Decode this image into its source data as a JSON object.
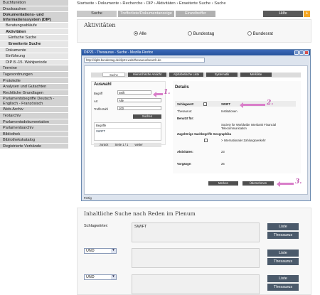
{
  "sidebar": {
    "items": [
      "Buchfunktion",
      "Drucksachen",
      "Dokumentations- und Informationssystem (DIP)",
      "Beratungsabläufe",
      "Aktivitäten",
      "Einfache Suche",
      "Erweiterte Suche",
      "Dokumente",
      "Einführung",
      "DIP 8.-15. Wahlperiode",
      "Termine",
      "Tagesordnungen",
      "Protokolle",
      "Analysen und Gutachten",
      "Rechtliche Grundlagen",
      "Parlamentsbegriffe Deutsch - Englisch - Französisch",
      "Web-Archiv",
      "Textarchiv",
      "Parlamentsdokumentation",
      "Parlamentsarchiv",
      "Bibliothek",
      "Bibliothekskatalog",
      "Registrierte Verbände"
    ]
  },
  "breadcrumb": "Startseite › Dokumente › Recherche › DIP › Aktivitäten › Erweiterte Suche › Suche",
  "tabs": {
    "suche": "Suche",
    "trefferliste": "Trefferliste/Dokumentanzeige",
    "einzel": "Einzeltreffer",
    "hilfe": "Hilfe",
    "plus": "+"
  },
  "aktivitaeten": {
    "title": "Aktivitäten",
    "options": [
      "Alle",
      "Bundestag",
      "Bundesrat"
    ],
    "selected": "Alle"
  },
  "firefox": {
    "title": "DIP21 - Thesaurus - Suche - Mozilla Firefox",
    "url": "http://dipbt.bundestag.de/dip21.web/thesaurus/search.do",
    "tabs": [
      "Suche",
      "Hierarchische Ansicht",
      "Alphabetische Liste",
      "Systematik",
      "Merkliste"
    ],
    "auswahl": {
      "title": "Auswahl",
      "begriff_label": "Begriff",
      "begriff_value": "swift",
      "art_label": "Art",
      "art_value": "Alle",
      "trefferzahl_label": "Trefferzahl",
      "trefferzahl_value": "100",
      "suchen": "Suchen",
      "list_header": "Begriffe",
      "list_item": "SWIFT",
      "zurueck": "zurück",
      "seite": "Seite 1 / 1",
      "weiter": "weiter"
    },
    "details": {
      "title": "Details",
      "schlagwort_label": "Schlagwort:",
      "schlagwort_value": "SWIFT",
      "thesaurus_label": "Thesaurus:",
      "thesaurus_value": "Institutionen",
      "benutzt_label": "Benutzt für:",
      "benutzt_value": "Society for Worldwide Interbank Financial Telecommunication",
      "zugehoerige_label": "Zugehörige Sachbegriffe Geographika",
      "zugehoerige_value": "> Internationaler Zahlungsverkehr",
      "aktivitaeten_label": "Aktivitäten:",
      "aktivitaeten_value": "23",
      "vorgaenge_label": "Vorgänge:",
      "vorgaenge_value": "26",
      "merken": "Merken",
      "uebernehmen": "Übernehmen"
    },
    "status": "Fertig"
  },
  "annotations": [
    "1.",
    "2.",
    "3."
  ],
  "inhalt": {
    "title": "Inhaltliche Suche nach Reden im Plenum",
    "schlagwoerter_label": "Schlagwörter:",
    "field_value": "SWIFT",
    "und": "UND",
    "liste": "Liste",
    "thesaurus": "Thesaurus"
  },
  "colors": {
    "accent": "#f5a623",
    "nav": "#d2d2d2",
    "annotation": "#d97ec9"
  }
}
